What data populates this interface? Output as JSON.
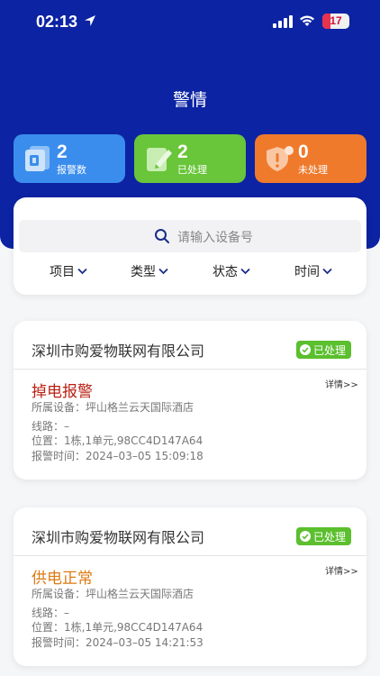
{
  "status_bar": {
    "time": "02:13",
    "battery": "17"
  },
  "page_title": "警情",
  "stats": [
    {
      "value": "2",
      "label": "报警数",
      "color": "#3a8ded",
      "icon": "alarm-list-icon"
    },
    {
      "value": "2",
      "label": "已处理",
      "color": "#69c53a",
      "icon": "edit-document-icon"
    },
    {
      "value": "0",
      "label": "未处理",
      "color": "#ef7a2c",
      "icon": "warning-shield-icon"
    }
  ],
  "search": {
    "placeholder": "请输入设备号"
  },
  "filters": [
    "项目",
    "类型",
    "状态",
    "时间"
  ],
  "labels": {
    "device": "所属设备：",
    "line": "线路：",
    "position": "位置：",
    "time": "报警时间：",
    "detail": "详情>>"
  },
  "alarms": [
    {
      "company": "深圳市购爱物联网有限公司",
      "status": "已处理",
      "type": "掉电报警",
      "type_color": "#b82015",
      "device": "坪山格兰云天国际酒店",
      "line": "–",
      "position": "1栋,1单元,98CC4D147A64",
      "time": "2024–03–05 15:09:18"
    },
    {
      "company": "深圳市购爱物联网有限公司",
      "status": "已处理",
      "type": "供电正常",
      "type_color": "#dc7a12",
      "device": "坪山格兰云天国际酒店",
      "line": "–",
      "position": "1栋,1单元,98CC4D147A64",
      "time": "2024–03–05 14:21:53"
    }
  ],
  "colors": {
    "header": "#0c23a3",
    "processed_badge": "#5bbf2e"
  }
}
